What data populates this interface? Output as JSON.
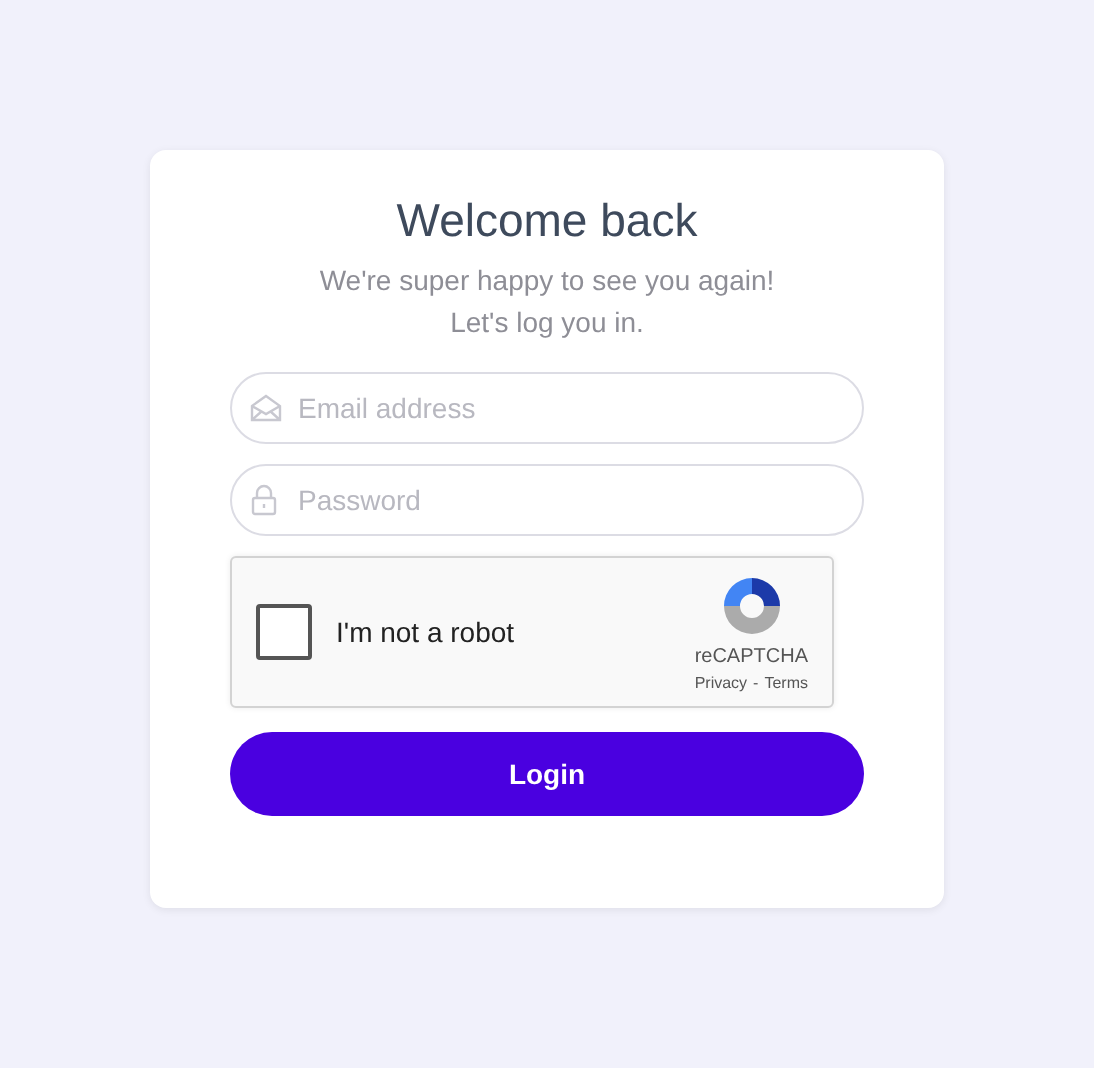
{
  "title": "Welcome back",
  "subtitle_lines": [
    "We're super happy to see you again!",
    "Let's log you in."
  ],
  "fields": [
    {
      "kind": "email",
      "placeholder": "Email address"
    },
    {
      "kind": "password",
      "placeholder": "Password"
    }
  ],
  "captcha": {
    "label": "I'm not a robot",
    "checked": false,
    "brand": "reCAPTCHA",
    "privacy": "Privacy",
    "separator": "-",
    "terms": "Terms"
  },
  "button": "Login"
}
